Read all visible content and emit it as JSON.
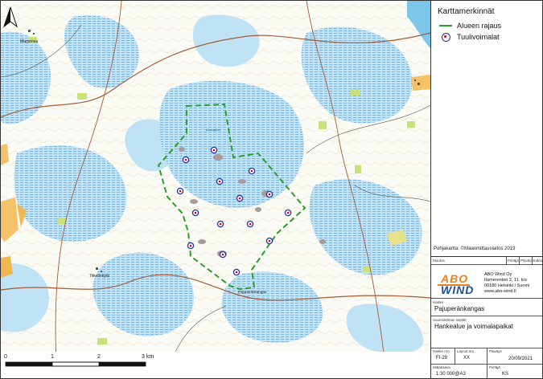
{
  "legend": {
    "title": "Karttamerkinnät",
    "items": [
      {
        "label": "Alueen rajaus",
        "color": "#2aa02a"
      },
      {
        "label": "Tuulivoimalat",
        "color": "#2233aa"
      }
    ]
  },
  "basemap_credit": "Pohjakartta: ©Maanmittauslaitos 2019",
  "map_labels": {
    "town_west": "Marjomaa",
    "town_southwest": "Tiikerinkylä",
    "lake_center": "Ahmajärvi",
    "road_south": "Pajuperänkangas"
  },
  "title_block": {
    "revision_label": "Muutos",
    "revision_cols": [
      "Piirtäjä",
      "Päiväys",
      "Index"
    ],
    "company": {
      "logo_top": "ABO",
      "logo_bottom": "WIND",
      "name": "ABO Wind Oy",
      "street": "Itämerentori 2, 11. krs",
      "city": "00180 Helsinki / Suomi",
      "web": "www.abo-wind.fi"
    },
    "project_label": "Hanke",
    "project": "Pajuperänkangas",
    "content_label": "Suunnitelman sisältö",
    "content": "Hankealue ja voimalapaikat",
    "project_no_label": "Hanke nro",
    "project_no": "FI-29",
    "layout_no_label": "Layout nro",
    "layout_no": "XX",
    "date_label": "Päiväys",
    "date": "20/09/2021",
    "scale_label": "Mittakaava",
    "scale": "1:30 000@A3",
    "drawer_label": "Piirtäjä",
    "drawer": "KS"
  },
  "scalebar": {
    "ticks": [
      "0",
      "1",
      "2",
      "3 km"
    ]
  },
  "turbines_count": 15
}
